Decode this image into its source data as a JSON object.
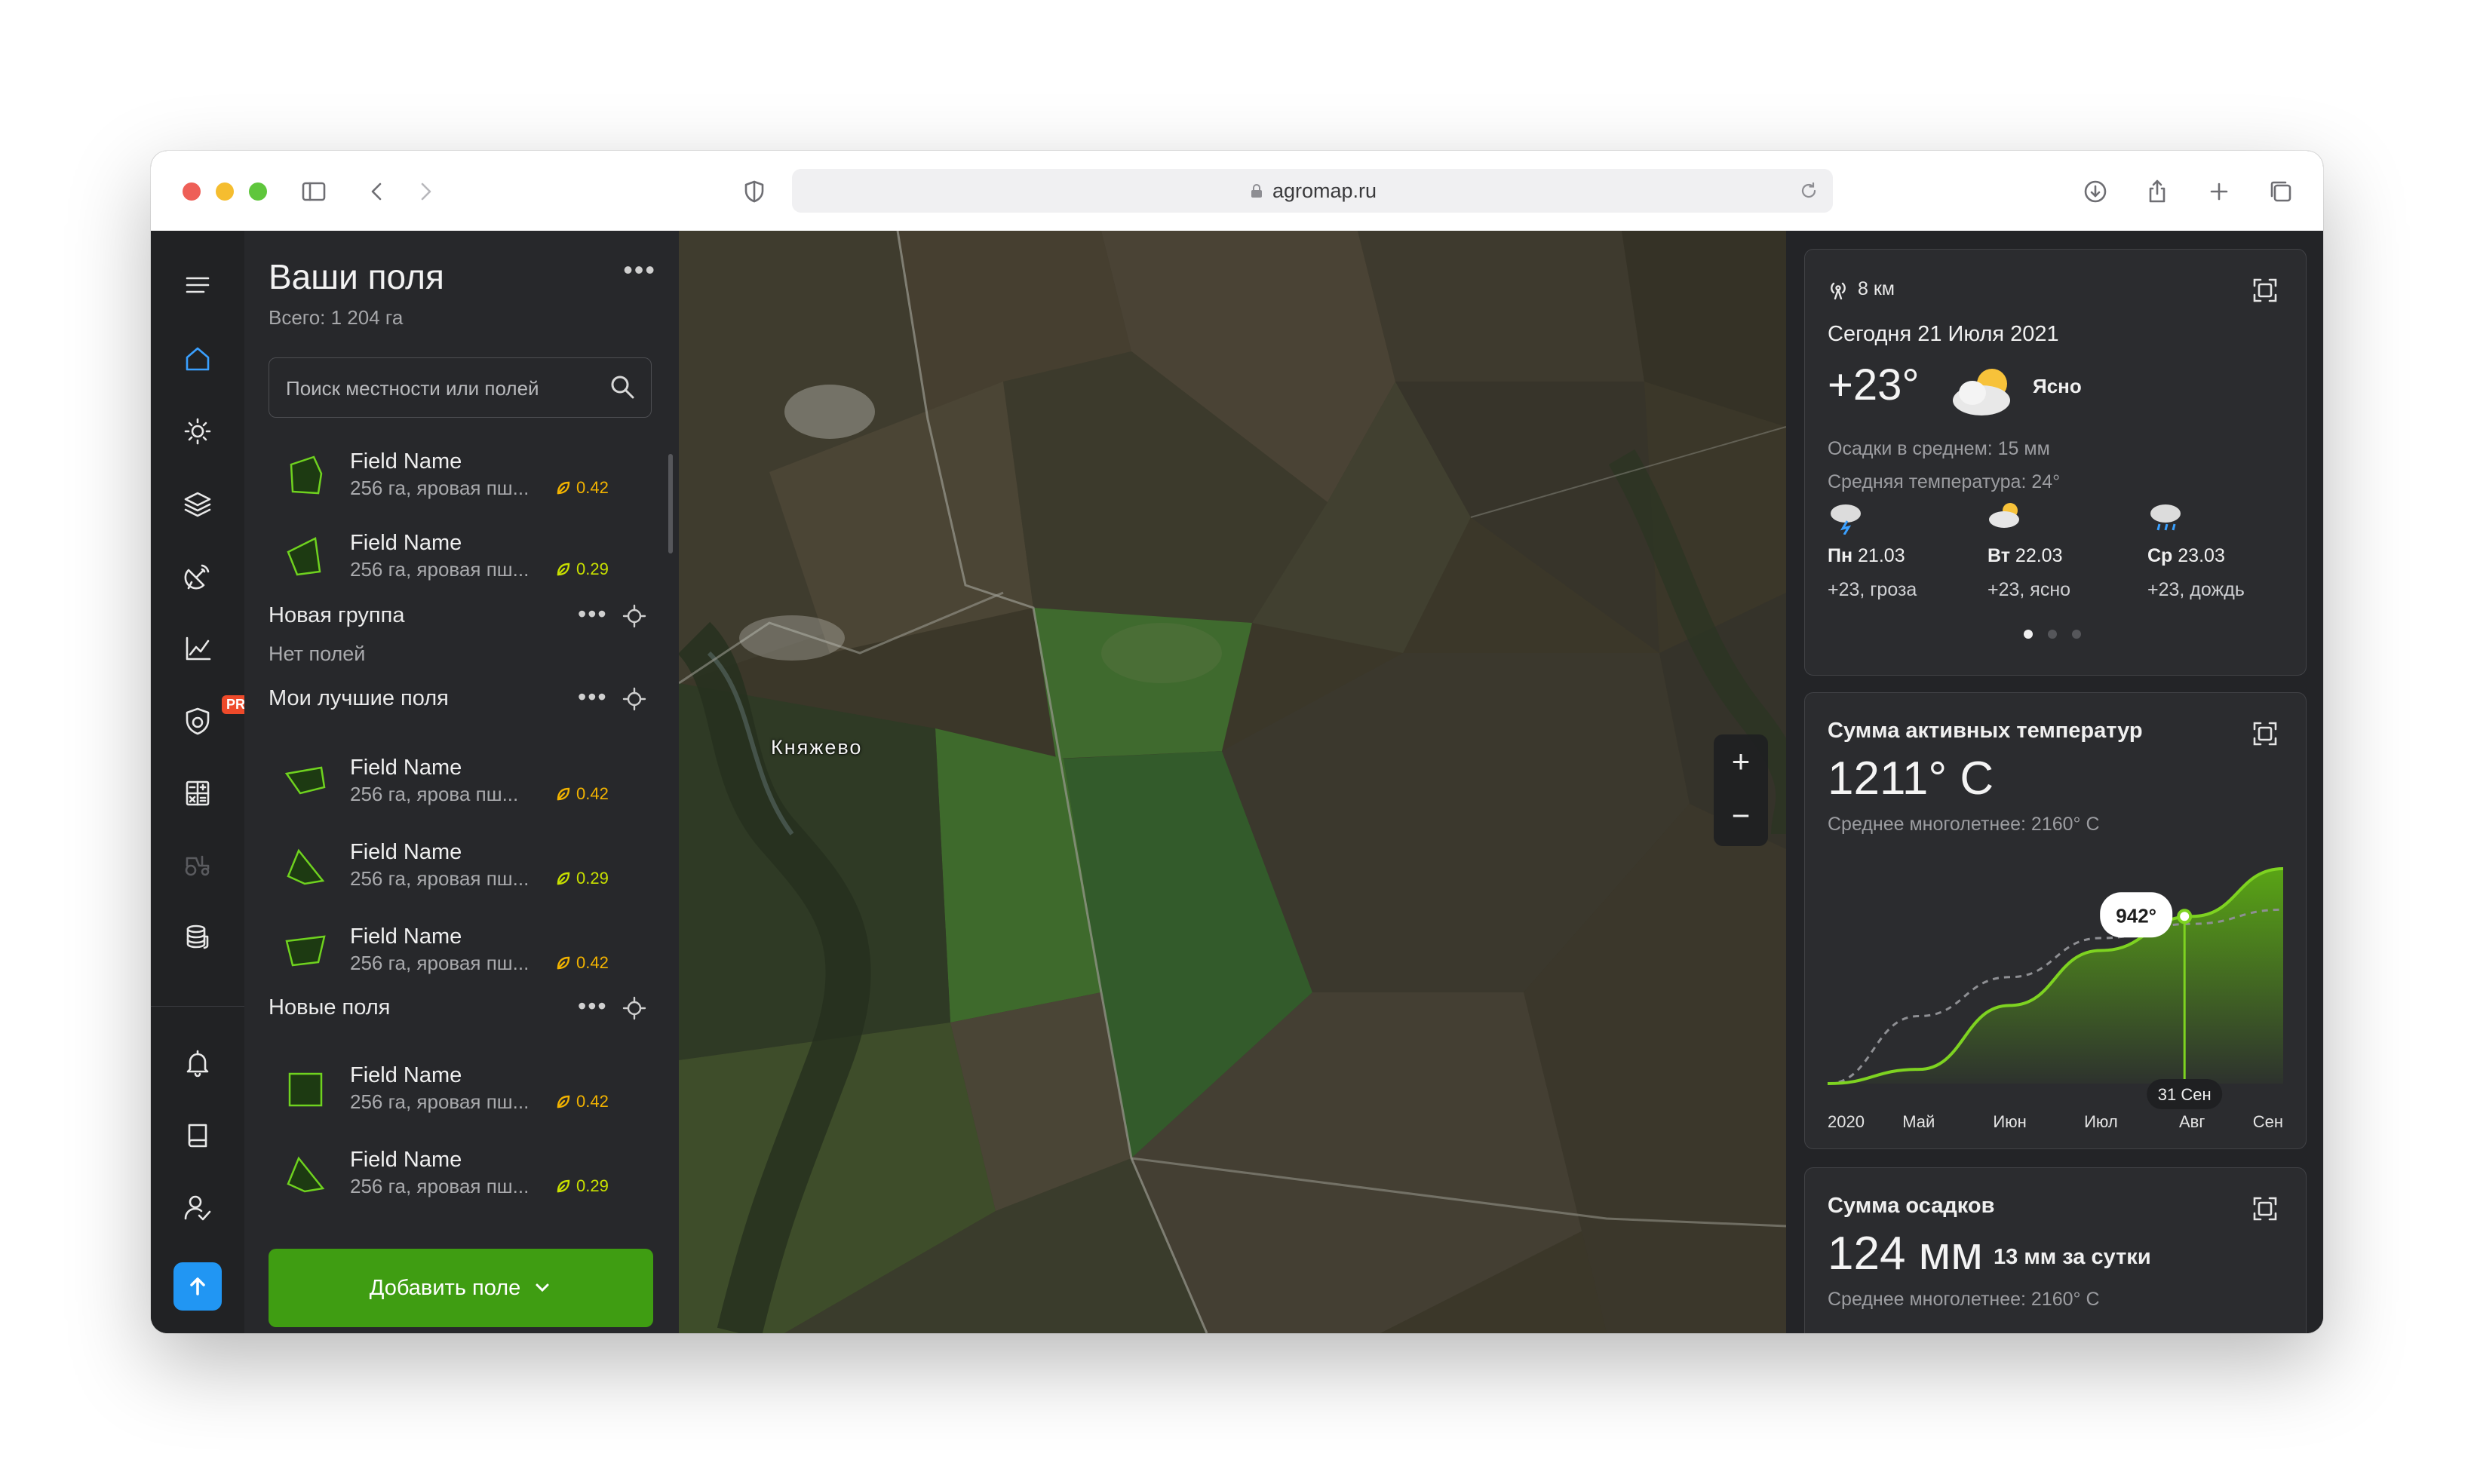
{
  "browser": {
    "url": "agromap.ru"
  },
  "panel": {
    "title": "Ваши поля",
    "total": "Всего: 1 204 га",
    "search_placeholder": "Поиск местности или полей",
    "add_button": "Добавить поле"
  },
  "fields_top": [
    {
      "name": "Field Name",
      "desc": "256 га, яровая пш...",
      "ndvi": "0.42",
      "ndvi_color": "#f2b300"
    },
    {
      "name": "Field Name",
      "desc": "256 га, яровая пш...",
      "ndvi": "0.29",
      "ndvi_color": "#c8e000"
    }
  ],
  "groups": [
    {
      "name": "Новая группа",
      "empty": "Нет полей",
      "fields": []
    },
    {
      "name": "Мои лучшие поля",
      "fields": [
        {
          "name": "Field Name",
          "desc": "256 га, ярова пш...",
          "ndvi": "0.42"
        },
        {
          "name": "Field Name",
          "desc": "256 га, яровая пш...",
          "ndvi": "0.29"
        },
        {
          "name": "Field Name",
          "desc": "256 га, яровая пш...",
          "ndvi": "0.42"
        }
      ]
    },
    {
      "name": "Новые поля",
      "fields": [
        {
          "name": "Field Name",
          "desc": "256 га, яровая пш...",
          "ndvi": "0.42"
        },
        {
          "name": "Field Name",
          "desc": "256 га, яровая пш...",
          "ndvi": "0.29"
        }
      ]
    }
  ],
  "rail": {
    "pro_badge": "PRO",
    "icons": [
      "menu-icon",
      "home-icon",
      "weather-icon",
      "layers-icon",
      "satellite-icon",
      "analytics-icon",
      "protection-icon",
      "calculator-icon",
      "tractor-icon",
      "coins-icon",
      "bell-icon",
      "book-icon",
      "user-check-icon",
      "arrow-up-icon"
    ]
  },
  "map": {
    "place_label": "Княжево",
    "zoom_in": "+",
    "zoom_out": "−"
  },
  "weather": {
    "distance": "8 км",
    "date": "Сегодня 21 Июля 2021",
    "temp": "+23°",
    "condition": "Ясно",
    "precip": "Осадки в среднем: 15 мм",
    "avg_temp": "Средняя температура:  24°",
    "forecast": [
      {
        "day": "Пн",
        "date": "21.03",
        "desc": "+23, гроза",
        "icon": "cloud-lightning-icon"
      },
      {
        "day": "Вт",
        "date": "22.03",
        "desc": "+23, ясно",
        "icon": "sun-cloud-icon"
      },
      {
        "day": "Ср",
        "date": "23.03",
        "desc": "+23, дождь",
        "icon": "cloud-rain-icon"
      }
    ]
  },
  "active_temp": {
    "title": "Сумма активных температур",
    "value": "1211° C",
    "avg": "Среднее многолетнее: 2160° C",
    "tooltip": "942°",
    "marker_label": "31 Сен",
    "accent": "#7ed321"
  },
  "precip_card": {
    "title": "Сумма осадков",
    "value": "124 мм",
    "per_day": "13 мм за сутки",
    "avg": "Среднее многолетнее: 2160° C"
  },
  "chart_data": {
    "type": "area",
    "title": "Сумма активных температур",
    "x": [
      "2020",
      "Май",
      "Июн",
      "Июл",
      "Авг",
      "Сен"
    ],
    "series": [
      {
        "name": "",
        "values": [
          0,
          80,
          440,
          750,
          942,
          1211
        ]
      },
      {
        "name": "",
        "values": [
          0,
          380,
          600,
          820,
          900,
          980
        ]
      }
    ],
    "ylim": [
      0,
      1300
    ],
    "highlight": {
      "label": "942°",
      "x_label": "31 Сен"
    }
  }
}
